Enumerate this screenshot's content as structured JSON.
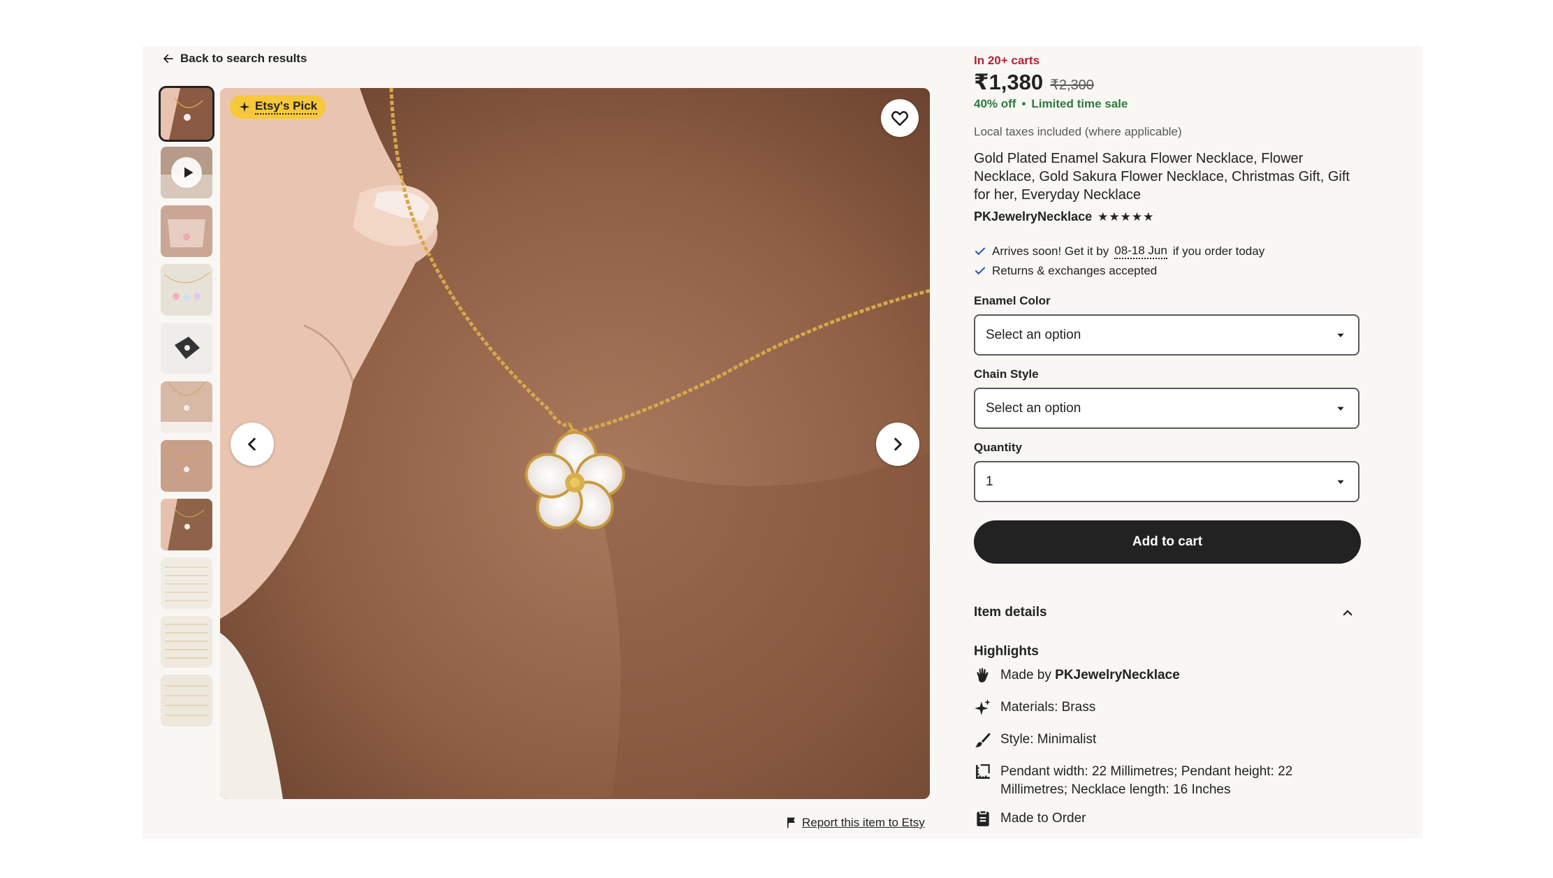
{
  "nav": {
    "back_label": "Back to search results"
  },
  "gallery": {
    "badge": "Etsy's Pick",
    "thumbnail_count": 11,
    "selected_index": 0,
    "report_label": "Report this item to Etsy"
  },
  "listing": {
    "carts_notice": "In 20+ carts",
    "price": "₹1,380",
    "original_price": "₹2,300",
    "discount": "40% off",
    "sale_separator": "•",
    "sale_label": "Limited time sale",
    "taxes_note": "Local taxes included (where applicable)",
    "title": "Gold Plated Enamel Sakura Flower Necklace, Flower Necklace, Gold Sakura Flower Necklace, Christmas Gift, Gift for her, Everyday Necklace",
    "shop_name": "PKJewelryNecklace",
    "rating_stars": "★★★★★",
    "rating_value": 5
  },
  "perks": {
    "arrives_prefix": "Arrives soon! Get it by",
    "arrives_date": "08-18 Jun",
    "arrives_suffix": "if you order today",
    "returns": "Returns & exchanges accepted"
  },
  "options": {
    "enamel_label": "Enamel Color",
    "enamel_value": "Select an option",
    "chain_label": "Chain Style",
    "chain_value": "Select an option",
    "quantity_label": "Quantity",
    "quantity_value": "1"
  },
  "cart": {
    "add_label": "Add to cart"
  },
  "details": {
    "header": "Item details",
    "highlights_title": "Highlights",
    "made_by_prefix": "Made by",
    "made_by_shop": "PKJewelryNecklace",
    "materials": "Materials: Brass",
    "style": "Style: Minimalist",
    "dimensions": "Pendant width: 22 Millimetres; Pendant height: 22 Millimetres; Necklace length: 16 Inches",
    "made_to_order": "Made to Order"
  },
  "colors": {
    "accent_dark": "#222222",
    "carts_red": "#b3213a",
    "sale_green": "#2f7a3b",
    "badge_yellow": "#f6c83a",
    "panel_bg": "#f8f7f4"
  },
  "icons": {
    "back": "arrow-left-icon",
    "badge": "sparkle-icon",
    "favorite": "heart-icon",
    "prev": "chevron-left-icon",
    "next": "chevron-right-icon",
    "report": "flag-icon",
    "check": "check-icon",
    "dropdown": "caret-down-icon",
    "collapse": "chevron-up-icon",
    "made_by": "hand-icon",
    "materials": "sparkle-icon",
    "style": "brush-icon",
    "dimensions": "ruler-corner-icon",
    "made_to_order": "clipboard-icon"
  }
}
